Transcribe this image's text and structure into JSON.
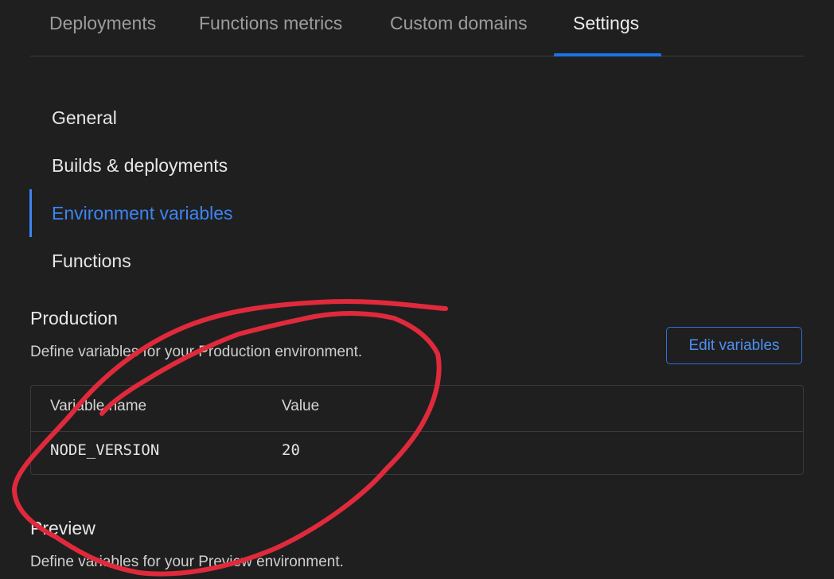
{
  "tabs": [
    {
      "label": "Deployments"
    },
    {
      "label": "Functions metrics"
    },
    {
      "label": "Custom domains"
    },
    {
      "label": "Settings"
    }
  ],
  "sidebar": {
    "items": [
      {
        "label": "General"
      },
      {
        "label": "Builds & deployments"
      },
      {
        "label": "Environment variables"
      },
      {
        "label": "Functions"
      }
    ]
  },
  "production": {
    "title": "Production",
    "description": "Define variables for your Production environment.",
    "edit_label": "Edit variables",
    "table": {
      "headers": [
        "Variable name",
        "Value"
      ],
      "rows": [
        {
          "name": "NODE_VERSION",
          "value": "20"
        }
      ]
    }
  },
  "preview": {
    "title": "Preview",
    "description": "Define variables for your Preview environment."
  },
  "colors": {
    "accent": "#1a73e8",
    "annotation": "#e02a3c",
    "background": "#1f1f20"
  }
}
